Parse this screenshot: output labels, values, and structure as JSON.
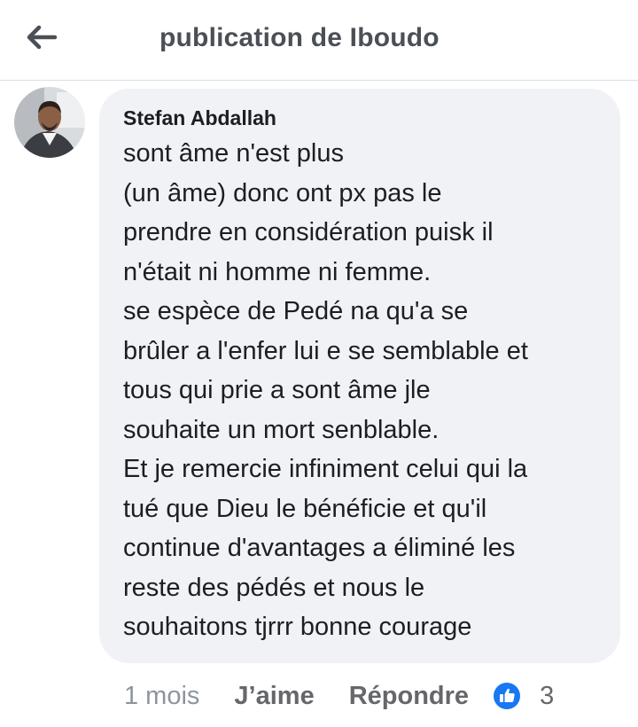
{
  "header": {
    "back_icon": "arrow-left-icon",
    "title": "publication de Iboudo"
  },
  "comment": {
    "author": "Stefan Abdallah",
    "avatar_icon": "profile-photo",
    "lines": [
      "sont âme n'est plus",
      "(un âme)  donc ont px pas le",
      "prendre en considération puisk il",
      "n'était ni homme ni femme.",
      "se espèce de Pedé na qu'a se",
      "brûler a l'enfer lui e se semblable et",
      "tous qui prie a sont âme jle",
      "souhaite un mort senblable.",
      "Et je remercie infiniment celui qui la",
      "tué que Dieu le bénéficie et qu'il",
      "continue d'avantages a éliminé les",
      "reste des pédés et nous le",
      "souhaitons tjrrr bonne courage"
    ]
  },
  "actions": {
    "time": "1 mois",
    "like_label": "J’aime",
    "reply_label": "Répondre",
    "reaction_icon": "thumbs-up-icon",
    "reaction_count": "3"
  },
  "colors": {
    "bubble_bg": "#f0f2f5",
    "like_blue": "#1877f2",
    "secondary_text": "#65676b"
  }
}
